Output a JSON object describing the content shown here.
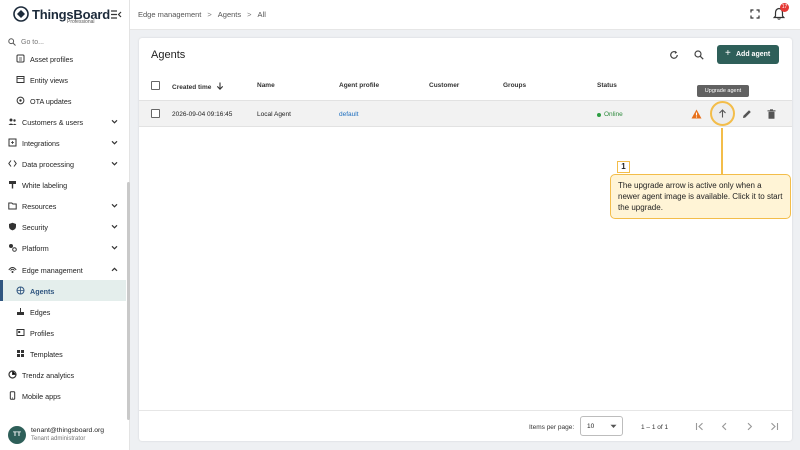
{
  "app": {
    "logo_text": "ThingsBoard",
    "logo_sub": "Professional"
  },
  "sidebar": {
    "search_placeholder": "Go to...",
    "items": [
      {
        "label": "Asset profiles",
        "icon": "asset-profiles-icon",
        "level": 2
      },
      {
        "label": "Entity views",
        "icon": "entity-views-icon",
        "level": 2
      },
      {
        "label": "OTA updates",
        "icon": "ota-updates-icon",
        "level": 2
      },
      {
        "label": "Customers & users",
        "icon": "customers-icon",
        "level": 1,
        "chevron": "down"
      },
      {
        "label": "Integrations",
        "icon": "integrations-icon",
        "level": 1,
        "chevron": "down"
      },
      {
        "label": "Data processing",
        "icon": "data-processing-icon",
        "level": 1,
        "chevron": "down"
      },
      {
        "label": "White labeling",
        "icon": "white-labeling-icon",
        "level": 1
      },
      {
        "label": "Resources",
        "icon": "resources-icon",
        "level": 1,
        "chevron": "down"
      },
      {
        "label": "Security",
        "icon": "security-icon",
        "level": 1,
        "chevron": "down"
      },
      {
        "label": "Platform",
        "icon": "platform-icon",
        "level": 1,
        "chevron": "down"
      },
      {
        "label": "Edge management",
        "icon": "edge-management-icon",
        "level": 1,
        "chevron": "up"
      },
      {
        "label": "Agents",
        "icon": "agents-icon",
        "level": 2,
        "active": true
      },
      {
        "label": "Edges",
        "icon": "edges-icon",
        "level": 2
      },
      {
        "label": "Profiles",
        "icon": "profiles-icon",
        "level": 2
      },
      {
        "label": "Templates",
        "icon": "templates-icon",
        "level": 2
      },
      {
        "label": "Trendz analytics",
        "icon": "trendz-icon",
        "level": 1
      },
      {
        "label": "Mobile apps",
        "icon": "mobile-apps-icon",
        "level": 1
      }
    ],
    "user": {
      "initials": "TT",
      "email": "tenant@thingsboard.org",
      "role": "Tenant administrator"
    }
  },
  "topbar": {
    "breadcrumb": [
      "Edge management",
      "Agents",
      "All"
    ],
    "breadcrumb_sep": ">",
    "notification_count": "17"
  },
  "card": {
    "title": "Agents",
    "add_label": "Add agent",
    "columns": [
      "Created time",
      "Name",
      "Agent profile",
      "Customer",
      "Groups",
      "Status"
    ],
    "rows": [
      {
        "created_time": "2026-09-04 09:16:45",
        "name": "Local Agent",
        "agent_profile": "default",
        "customer": "",
        "groups": "",
        "status": "Online"
      }
    ],
    "tooltip": "Upgrade agent",
    "footer": {
      "items_per_page_label": "Items per page:",
      "items_per_page_value": "10",
      "range": "1 – 1 of 1"
    }
  },
  "callout": {
    "number": "1",
    "text": "The upgrade arrow is active only when a newer agent image is available. Click it to start the upgrade."
  },
  "colors": {
    "accent": "#2e5f59",
    "link": "#1f6fbf",
    "status_online": "#2e8b3d",
    "highlight": "#f3bd4a",
    "callout_bg": "#fff4d6",
    "warning": "#e8701a"
  }
}
